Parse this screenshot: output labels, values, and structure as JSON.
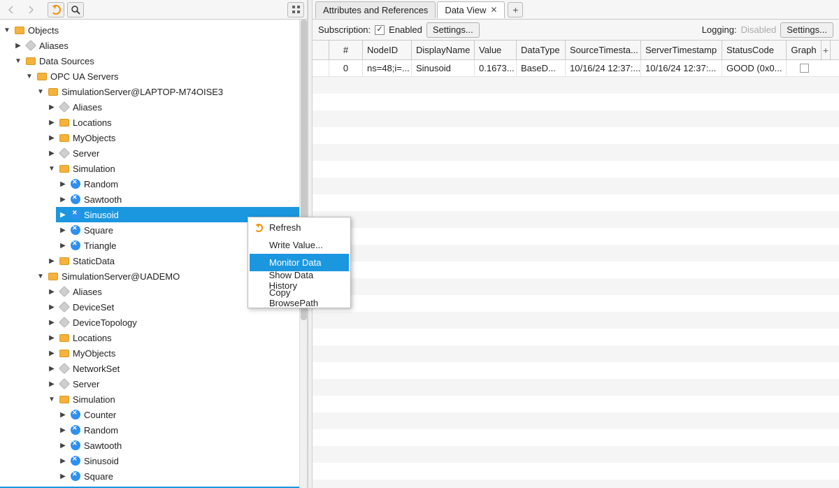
{
  "toolbar": {
    "back": "←",
    "forward": "→",
    "refresh": "↻",
    "search": "🔍",
    "collapse": "⤢"
  },
  "tree": {
    "root": "Objects",
    "root_children": [
      {
        "label": "Aliases",
        "icon": "object",
        "children": null
      },
      {
        "label": "Data Sources",
        "icon": "folder",
        "open": true,
        "children": [
          {
            "label": "OPC UA Servers",
            "icon": "folder",
            "open": true,
            "children": [
              {
                "label": "SimulationServer@LAPTOP-M74OISE3",
                "icon": "folder",
                "open": true,
                "children": [
                  {
                    "label": "Aliases",
                    "icon": "object"
                  },
                  {
                    "label": "Locations",
                    "icon": "folder"
                  },
                  {
                    "label": "MyObjects",
                    "icon": "folder"
                  },
                  {
                    "label": "Server",
                    "icon": "object"
                  },
                  {
                    "label": "Simulation",
                    "icon": "folder",
                    "open": true,
                    "children": [
                      {
                        "label": "Random",
                        "icon": "var"
                      },
                      {
                        "label": "Sawtooth",
                        "icon": "var"
                      },
                      {
                        "label": "Sinusoid",
                        "icon": "var",
                        "selected": true
                      },
                      {
                        "label": "Square",
                        "icon": "var"
                      },
                      {
                        "label": "Triangle",
                        "icon": "var"
                      }
                    ]
                  },
                  {
                    "label": "StaticData",
                    "icon": "folder"
                  }
                ]
              },
              {
                "label": "SimulationServer@UADEMO",
                "icon": "folder",
                "open": true,
                "children": [
                  {
                    "label": "Aliases",
                    "icon": "object"
                  },
                  {
                    "label": "DeviceSet",
                    "icon": "object"
                  },
                  {
                    "label": "DeviceTopology",
                    "icon": "object"
                  },
                  {
                    "label": "Locations",
                    "icon": "folder"
                  },
                  {
                    "label": "MyObjects",
                    "icon": "folder"
                  },
                  {
                    "label": "NetworkSet",
                    "icon": "object"
                  },
                  {
                    "label": "Server",
                    "icon": "object"
                  },
                  {
                    "label": "Simulation",
                    "icon": "folder",
                    "open": true,
                    "children": [
                      {
                        "label": "Counter",
                        "icon": "var"
                      },
                      {
                        "label": "Random",
                        "icon": "var"
                      },
                      {
                        "label": "Sawtooth",
                        "icon": "var"
                      },
                      {
                        "label": "Sinusoid",
                        "icon": "var"
                      },
                      {
                        "label": "Square",
                        "icon": "var"
                      }
                    ]
                  }
                ]
              }
            ]
          }
        ]
      }
    ]
  },
  "context_menu": {
    "items": [
      {
        "label": "Refresh",
        "icon": "refresh"
      },
      {
        "label": "Write Value..."
      },
      {
        "label": "Monitor Data",
        "selected": true
      },
      {
        "label": "Show Data History"
      },
      {
        "label": "Copy BrowsePath"
      }
    ]
  },
  "tabs": {
    "items": [
      {
        "label": "Attributes and References",
        "active": false,
        "closable": false
      },
      {
        "label": "Data View",
        "active": true,
        "closable": true
      }
    ]
  },
  "subbar": {
    "subscription_label": "Subscription:",
    "enabled_label": "Enabled",
    "enabled_checked": true,
    "settings1": "Settings...",
    "logging_label": "Logging:",
    "disabled_label": "Disabled",
    "settings2": "Settings..."
  },
  "grid": {
    "columns": [
      "#",
      "NodeID",
      "DisplayName",
      "Value",
      "DataType",
      "SourceTimesta...",
      "ServerTimestamp",
      "StatusCode",
      "Graph"
    ],
    "rows": [
      {
        "idx": "0",
        "node": "ns=48;i=...",
        "disp": "Sinusoid",
        "val": "0.1673...",
        "type": "BaseD...",
        "src": "10/16/24 12:37:...",
        "srv": "10/16/24 12:37:...",
        "stat": "GOOD (0x0...",
        "graph": false
      }
    ]
  }
}
